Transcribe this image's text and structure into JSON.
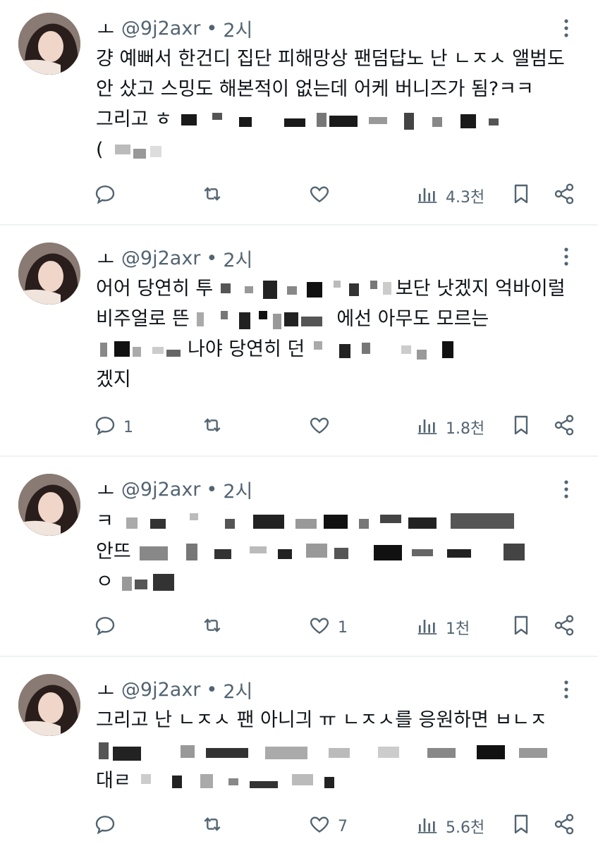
{
  "posts": [
    {
      "name": "ㅗ",
      "handle": "@9j2axr",
      "dot": "•",
      "time": "2시",
      "lines": [
        {
          "text": "걍 예뻐서 한건디 집단 피해망상 팬덤답노 난 ㄴㅈㅅ 앨범도",
          "mask_after": ""
        },
        {
          "text": "안 샀고 스밍도 해본적이 없는데 어케 버니즈가 됨?ㅋㅋ",
          "mask_after": ""
        },
        {
          "text": "그리고 ㅎ",
          "mask_after": "true"
        },
        {
          "text": "(",
          "mask_after": "true"
        }
      ],
      "reply_count": "",
      "like_count": "",
      "views": "4.3천"
    },
    {
      "name": "ㅗ",
      "handle": "@9j2axr",
      "dot": "•",
      "time": "2시",
      "lines": [
        {
          "text": "어어 당연히 투",
          "mask_after": "true",
          "tail": "보단 낫겠지 억바이럴"
        },
        {
          "text": "비주얼로 뜬 ",
          "mask_after": "true",
          "tail": "에선 아무도 모르는"
        },
        {
          "text": "",
          "mask_after": "true",
          "tail": "나야 당연히 던"
        },
        {
          "text": "겠지",
          "mask_after": ""
        }
      ],
      "reply_count": "1",
      "like_count": "",
      "views": "1.8천"
    },
    {
      "name": "ㅗ",
      "handle": "@9j2axr",
      "dot": "•",
      "time": "2시",
      "lines": [
        {
          "text": "ㅋ",
          "mask_after": "true"
        },
        {
          "text": "안뜨",
          "mask_after": "true"
        },
        {
          "text": "ㅇ",
          "mask_after": "true"
        }
      ],
      "reply_count": "",
      "like_count": "1",
      "views": "1천"
    },
    {
      "name": "ㅗ",
      "handle": "@9j2axr",
      "dot": "•",
      "time": "2시",
      "lines": [
        {
          "text": "그리고 난 ㄴㅈㅅ 팬 아니긔 ㅠ ㄴㅈㅅ를 응원하면 ㅂㄴㅈ",
          "mask_after": ""
        },
        {
          "text": "",
          "mask_after": "true"
        },
        {
          "text": "대ㄹ",
          "mask_after": "true"
        }
      ],
      "reply_count": "",
      "like_count": "7",
      "views": "5.6천"
    }
  ],
  "icons": {
    "reply": "reply-icon",
    "retweet": "retweet-icon",
    "like": "heart-icon",
    "views": "views-icon",
    "bookmark": "bookmark-icon",
    "share": "share-icon",
    "more": "more-icon"
  },
  "colors": {
    "text": "#0f1419",
    "secondary": "#536471",
    "divider": "#eff3f4"
  }
}
